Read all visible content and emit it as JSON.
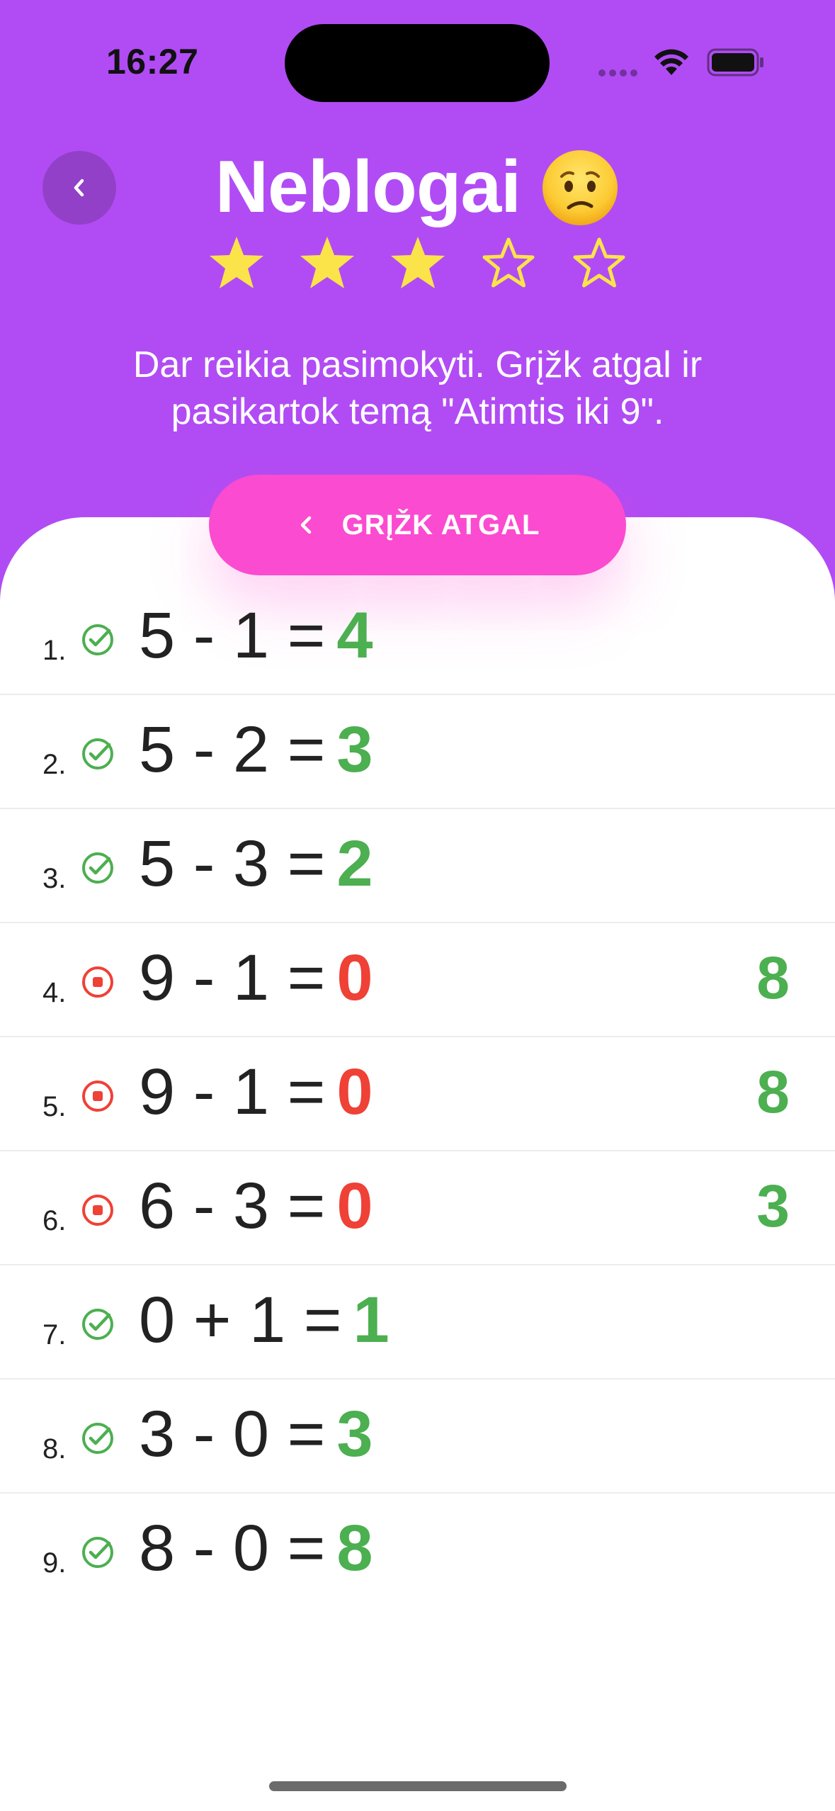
{
  "status_bar": {
    "time": "16:27"
  },
  "header": {
    "back_icon": "chevron-left-icon",
    "title": "Neblogai",
    "emoji": "confused-face-emoji",
    "stars": {
      "filled": 3,
      "total": 5
    },
    "message": "Dar reikia pasimokyti. Grįžk atgal ir pasikartok temą \"Atimtis iki 9\".",
    "button_label": "GRĮŽK ATGAL",
    "button_icon": "chevron-left-icon"
  },
  "colors": {
    "header_bg": "#b14cf4",
    "button_bg": "#fb4bd0",
    "star": "#fbe44a",
    "correct": "#4caf50",
    "wrong": "#ef4136"
  },
  "results": [
    {
      "num": "1.",
      "status": "correct",
      "expression": "5 - 1 =",
      "answer": "4",
      "correct_answer": ""
    },
    {
      "num": "2.",
      "status": "correct",
      "expression": "5 - 2 =",
      "answer": "3",
      "correct_answer": ""
    },
    {
      "num": "3.",
      "status": "correct",
      "expression": "5 - 3 =",
      "answer": "2",
      "correct_answer": ""
    },
    {
      "num": "4.",
      "status": "wrong",
      "expression": "9 - 1 =",
      "answer": "0",
      "correct_answer": "8"
    },
    {
      "num": "5.",
      "status": "wrong",
      "expression": "9 - 1 =",
      "answer": "0",
      "correct_answer": "8"
    },
    {
      "num": "6.",
      "status": "wrong",
      "expression": "6 - 3 =",
      "answer": "0",
      "correct_answer": "3"
    },
    {
      "num": "7.",
      "status": "correct",
      "expression": "0 + 1 =",
      "answer": "1",
      "correct_answer": ""
    },
    {
      "num": "8.",
      "status": "correct",
      "expression": "3 - 0 =",
      "answer": "3",
      "correct_answer": ""
    },
    {
      "num": "9.",
      "status": "correct",
      "expression": "8 - 0 =",
      "answer": "8",
      "correct_answer": ""
    }
  ]
}
